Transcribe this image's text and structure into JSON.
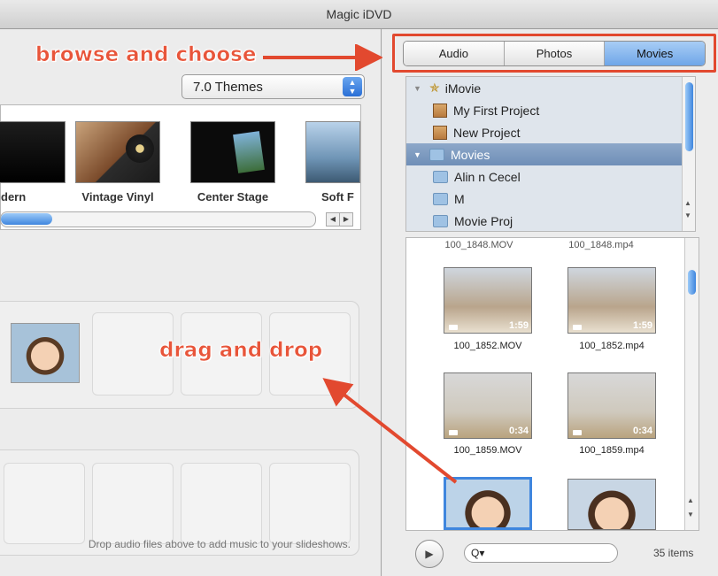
{
  "window": {
    "title": "Magic iDVD"
  },
  "annotations": {
    "browse": "browse and choose",
    "drag": "drag and drop"
  },
  "themes": {
    "selected": "7.0 Themes",
    "items": [
      {
        "label": "dern"
      },
      {
        "label": "Vintage Vinyl"
      },
      {
        "label": "Center Stage"
      },
      {
        "label": "Soft F"
      }
    ]
  },
  "drop_hint": "Drop audio files above to add music to your slideshows.",
  "media_tabs": [
    {
      "label": "Audio",
      "active": false
    },
    {
      "label": "Photos",
      "active": false
    },
    {
      "label": "Movies",
      "active": true
    }
  ],
  "source_list": [
    {
      "label": "iMovie",
      "kind": "star-icon",
      "level": 0,
      "selected": false
    },
    {
      "label": "My First Project",
      "kind": "project-icon",
      "level": 1,
      "selected": false
    },
    {
      "label": "New Project",
      "kind": "project-icon",
      "level": 1,
      "selected": false
    },
    {
      "label": "Movies",
      "kind": "folder-icon",
      "level": 0,
      "selected": true
    },
    {
      "label": "Alin n Cecel",
      "kind": "folder-icon",
      "level": 1,
      "selected": false
    },
    {
      "label": "M",
      "kind": "folder-icon",
      "level": 1,
      "selected": false
    },
    {
      "label": "Movie Proj",
      "kind": "folder-icon",
      "level": 1,
      "selected": false
    }
  ],
  "media": {
    "partial_top": [
      "100_1848.MOV",
      "100_1848.mp4"
    ],
    "items": [
      {
        "name": "100_1852.MOV",
        "duration": "1:59"
      },
      {
        "name": "100_1852.mp4",
        "duration": "1:59"
      },
      {
        "name": "100_1859.MOV",
        "duration": "0:34"
      },
      {
        "name": "100_1859.mp4",
        "duration": "0:34"
      }
    ]
  },
  "search": {
    "placeholder": "Q▾"
  },
  "count": "35 items",
  "colors": {
    "callout": "#e8553a",
    "selection_blue": "#6fa6e8"
  }
}
